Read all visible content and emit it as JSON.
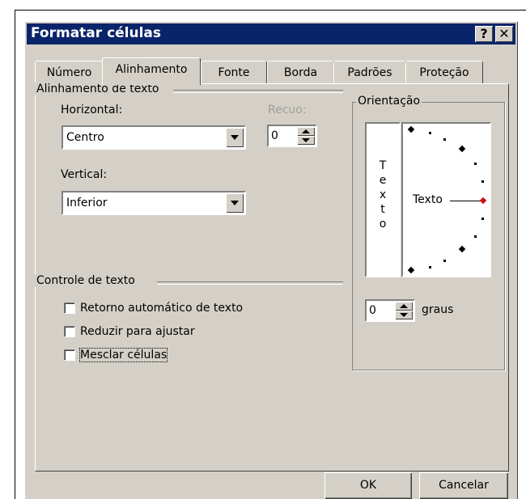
{
  "window": {
    "title": "Formatar células",
    "help_glyph": "?",
    "close_glyph": "✕"
  },
  "tabs": [
    {
      "label": "Número"
    },
    {
      "label": "Alinhamento",
      "active": true
    },
    {
      "label": "Fonte"
    },
    {
      "label": "Borda"
    },
    {
      "label": "Padrões"
    },
    {
      "label": "Proteção"
    }
  ],
  "text_alignment": {
    "group_label": "Alinhamento de texto",
    "horizontal_label": "Horizontal:",
    "horizontal_value": "Centro",
    "indent_label": "Recuo:",
    "indent_value": "0",
    "vertical_label": "Vertical:",
    "vertical_value": "Inferior"
  },
  "text_control": {
    "group_label": "Controle de texto",
    "wrap_text": {
      "label": "Retorno automático de texto",
      "checked": false
    },
    "shrink_to_fit": {
      "label": "Reduzir para ajustar",
      "checked": false
    },
    "merge_cells": {
      "label": "Mesclar células",
      "checked": false
    }
  },
  "orientation": {
    "group_label": "Orientação",
    "vertical_text_chars": [
      "T",
      "e",
      "x",
      "t",
      "o"
    ],
    "dial_label": "Texto",
    "degrees_value": "0",
    "degrees_label": "graus",
    "indicator_color": "#d01010"
  },
  "buttons": {
    "ok": "OK",
    "cancel": "Cancelar"
  }
}
